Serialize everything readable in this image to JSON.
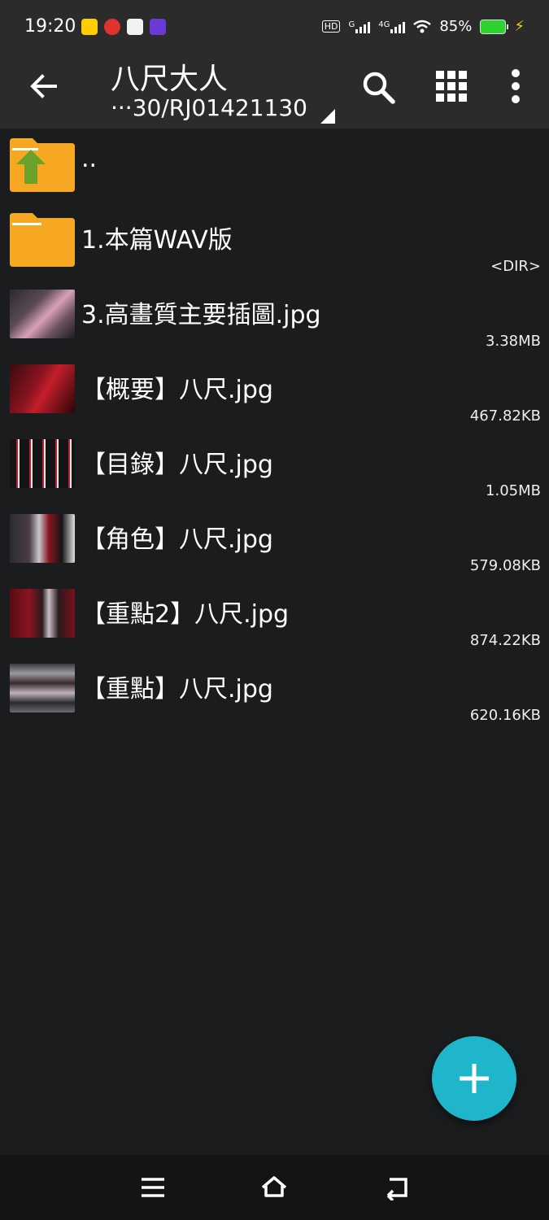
{
  "status_bar": {
    "time": "19:20",
    "hd_label": "HD",
    "sim1_label": "G",
    "sim2_label": "4G",
    "battery_percent": "85%",
    "battery_level": 0.85,
    "notification_icons": [
      "meituan-icon",
      "netease-music-icon",
      "document-app-icon",
      "purple-app-icon"
    ]
  },
  "toolbar": {
    "title": "八尺大人",
    "path": "···30/RJ01421130",
    "icons": [
      "back-arrow-icon",
      "search-icon",
      "grid-view-icon",
      "more-vert-icon"
    ]
  },
  "files": [
    {
      "name": "..",
      "size": "",
      "kind": "parent"
    },
    {
      "name": "1.本篇WAV版",
      "size": "<DIR>",
      "kind": "folder"
    },
    {
      "name": "3.高畫質主要插圖.jpg",
      "size": "3.38MB",
      "kind": "image"
    },
    {
      "name": "【概要】八尺.jpg",
      "size": "467.82KB",
      "kind": "image"
    },
    {
      "name": "【目錄】八尺.jpg",
      "size": "1.05MB",
      "kind": "image"
    },
    {
      "name": "【角色】八尺.jpg",
      "size": "579.08KB",
      "kind": "image"
    },
    {
      "name": "【重點2】八尺.jpg",
      "size": "874.22KB",
      "kind": "image"
    },
    {
      "name": "【重點】八尺.jpg",
      "size": "620.16KB",
      "kind": "image"
    }
  ],
  "fab": {
    "icon": "plus-icon",
    "label": "+"
  },
  "nav_bar": {
    "icons": [
      "menu-icon",
      "home-icon",
      "back-icon"
    ]
  },
  "colors": {
    "background": "#1b1c1e",
    "toolbar": "#2b2b2b",
    "folder": "#f7a823",
    "fab": "#1fb6cc",
    "up_arrow": "#6aa12a"
  }
}
